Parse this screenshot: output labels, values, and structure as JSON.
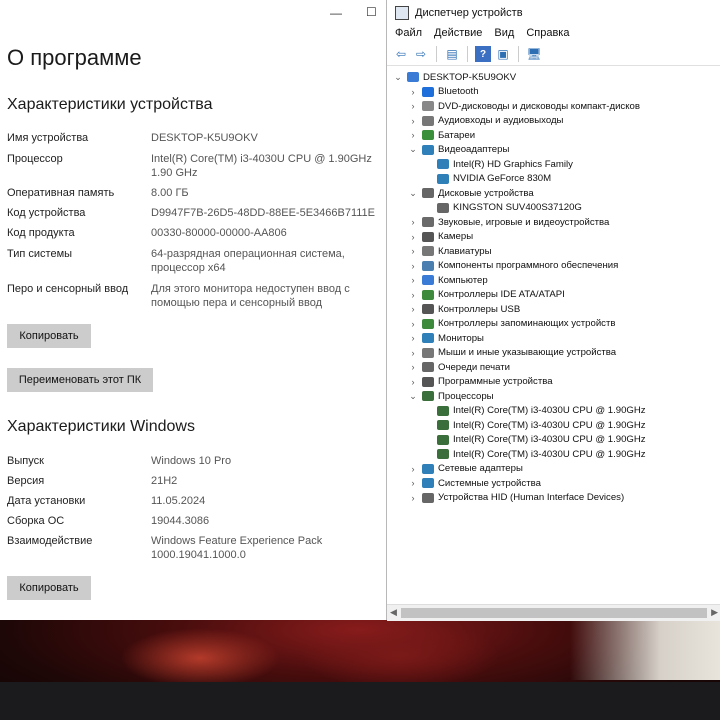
{
  "settings": {
    "title": "О программе",
    "window_controls": {
      "minimize": "—",
      "maximize": "☐"
    },
    "device_specs": {
      "heading": "Характеристики устройства",
      "rows": [
        {
          "key": "Имя устройства",
          "value": "DESKTOP-K5U9OKV"
        },
        {
          "key": "Процессор",
          "value": "Intel(R) Core(TM) i3-4030U CPU @ 1.90GHz 1.90 GHz"
        },
        {
          "key": "Оперативная память",
          "value": "8.00 ГБ"
        },
        {
          "key": "Код устройства",
          "value": "D9947F7B-26D5-48DD-88EE-5E3466B7111E"
        },
        {
          "key": "Код продукта",
          "value": "00330-80000-00000-AA806"
        },
        {
          "key": "Тип системы",
          "value": "64-разрядная операционная система, процессор x64"
        },
        {
          "key": "Перо и сенсорный ввод",
          "value": "Для этого монитора недоступен ввод с помощью пера и сенсорный ввод"
        }
      ],
      "copy_button": "Копировать",
      "rename_button": "Переименовать этот ПК"
    },
    "windows_specs": {
      "heading": "Характеристики Windows",
      "rows": [
        {
          "key": "Выпуск",
          "value": "Windows 10 Pro"
        },
        {
          "key": "Версия",
          "value": "21H2"
        },
        {
          "key": "Дата установки",
          "value": "11.05.2024"
        },
        {
          "key": "Сборка ОС",
          "value": "19044.3086"
        },
        {
          "key": "Взаимодействие",
          "value": "Windows Feature Experience Pack 1000.19041.1000.0"
        }
      ],
      "copy_button": "Копировать"
    }
  },
  "device_manager": {
    "title": "Диспетчер устройств",
    "menu": [
      "Файл",
      "Действие",
      "Вид",
      "Справка"
    ],
    "tree": [
      {
        "label": "DESKTOP-K5U9OKV",
        "level": 0,
        "expander": "v",
        "icon": "computer-icon",
        "color": "#3a7bd5"
      },
      {
        "label": "Bluetooth",
        "level": 1,
        "expander": ">",
        "icon": "bluetooth-icon",
        "color": "#1e6fd9"
      },
      {
        "label": "DVD-дисководы и дисководы компакт-дисков",
        "level": 1,
        "expander": ">",
        "icon": "dvd-icon",
        "color": "#888888"
      },
      {
        "label": "Аудиовходы и аудиовыходы",
        "level": 1,
        "expander": ">",
        "icon": "speaker-icon",
        "color": "#777777"
      },
      {
        "label": "Батареи",
        "level": 1,
        "expander": ">",
        "icon": "battery-icon",
        "color": "#3a8f3a"
      },
      {
        "label": "Видеоадаптеры",
        "level": 1,
        "expander": "v",
        "icon": "display-adapter-icon",
        "color": "#2f7fb8"
      },
      {
        "label": "Intel(R) HD Graphics Family",
        "level": 2,
        "expander": "",
        "icon": "display-adapter-icon",
        "color": "#2f7fb8"
      },
      {
        "label": "NVIDIA GeForce 830M",
        "level": 2,
        "expander": "",
        "icon": "display-adapter-icon",
        "color": "#2f7fb8"
      },
      {
        "label": "Дисковые устройства",
        "level": 1,
        "expander": "v",
        "icon": "disk-icon",
        "color": "#666666"
      },
      {
        "label": "KINGSTON SUV400S37120G",
        "level": 2,
        "expander": "",
        "icon": "disk-icon",
        "color": "#666666"
      },
      {
        "label": "Звуковые, игровые и видеоустройства",
        "level": 1,
        "expander": ">",
        "icon": "sound-icon",
        "color": "#6a6a6a"
      },
      {
        "label": "Камеры",
        "level": 1,
        "expander": ">",
        "icon": "camera-icon",
        "color": "#555555"
      },
      {
        "label": "Клавиатуры",
        "level": 1,
        "expander": ">",
        "icon": "keyboard-icon",
        "color": "#777777"
      },
      {
        "label": "Компоненты программного обеспечения",
        "level": 1,
        "expander": ">",
        "icon": "software-component-icon",
        "color": "#4a7fb0"
      },
      {
        "label": "Компьютер",
        "level": 1,
        "expander": ">",
        "icon": "computer-icon",
        "color": "#3a7bd5"
      },
      {
        "label": "Контроллеры IDE ATA/ATAPI",
        "level": 1,
        "expander": ">",
        "icon": "ide-controller-icon",
        "color": "#3d8a3d"
      },
      {
        "label": "Контроллеры USB",
        "level": 1,
        "expander": ">",
        "icon": "usb-icon",
        "color": "#555555"
      },
      {
        "label": "Контроллеры запоминающих устройств",
        "level": 1,
        "expander": ">",
        "icon": "storage-controller-icon",
        "color": "#3d8a3d"
      },
      {
        "label": "Мониторы",
        "level": 1,
        "expander": ">",
        "icon": "monitor-icon",
        "color": "#2f7fb8"
      },
      {
        "label": "Мыши и иные указывающие устройства",
        "level": 1,
        "expander": ">",
        "icon": "mouse-icon",
        "color": "#777777"
      },
      {
        "label": "Очереди печати",
        "level": 1,
        "expander": ">",
        "icon": "printer-icon",
        "color": "#666666"
      },
      {
        "label": "Программные устройства",
        "level": 1,
        "expander": ">",
        "icon": "software-device-icon",
        "color": "#555555"
      },
      {
        "label": "Процессоры",
        "level": 1,
        "expander": "v",
        "icon": "processor-icon",
        "color": "#3a6e3a"
      },
      {
        "label": "Intel(R) Core(TM) i3-4030U CPU @ 1.90GHz",
        "level": 2,
        "expander": "",
        "icon": "processor-icon",
        "color": "#3a6e3a"
      },
      {
        "label": "Intel(R) Core(TM) i3-4030U CPU @ 1.90GHz",
        "level": 2,
        "expander": "",
        "icon": "processor-icon",
        "color": "#3a6e3a"
      },
      {
        "label": "Intel(R) Core(TM) i3-4030U CPU @ 1.90GHz",
        "level": 2,
        "expander": "",
        "icon": "processor-icon",
        "color": "#3a6e3a"
      },
      {
        "label": "Intel(R) Core(TM) i3-4030U CPU @ 1.90GHz",
        "level": 2,
        "expander": "",
        "icon": "processor-icon",
        "color": "#3a6e3a"
      },
      {
        "label": "Сетевые адаптеры",
        "level": 1,
        "expander": ">",
        "icon": "network-adapter-icon",
        "color": "#2f7fb8"
      },
      {
        "label": "Системные устройства",
        "level": 1,
        "expander": ">",
        "icon": "system-device-icon",
        "color": "#2f7fb8"
      },
      {
        "label": "Устройства HID (Human Interface Devices)",
        "level": 1,
        "expander": ">",
        "icon": "hid-icon",
        "color": "#666666"
      }
    ]
  }
}
